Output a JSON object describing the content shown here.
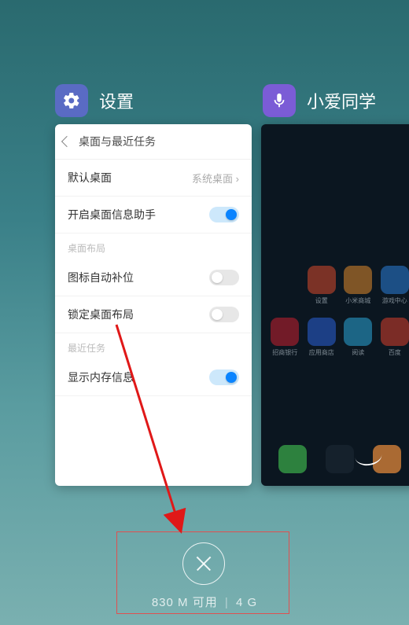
{
  "cards": {
    "left": {
      "title": "设置",
      "panel_title": "桌面与最近任务",
      "rows": [
        {
          "kind": "valueRow",
          "label": "默认桌面",
          "value": "系统桌面"
        },
        {
          "kind": "toggleRow",
          "label": "开启桌面信息助手",
          "on": true
        },
        {
          "kind": "section",
          "label": "桌面布局"
        },
        {
          "kind": "toggleRow",
          "label": "图标自动补位",
          "on": false
        },
        {
          "kind": "toggleRow",
          "label": "锁定桌面布局",
          "on": false
        },
        {
          "kind": "section",
          "label": "最近任务"
        },
        {
          "kind": "toggleRow",
          "label": "显示内存信息",
          "on": true
        }
      ]
    },
    "right": {
      "title": "小爱同学",
      "apps_row1": [
        {
          "name": "设置",
          "color": "#d84a2c"
        },
        {
          "name": "小米商城",
          "color": "#e08a2c"
        },
        {
          "name": "游戏中心",
          "color": "#2c7fd8"
        }
      ],
      "apps_row2": [
        {
          "name": "招商银行",
          "color": "#c92030"
        },
        {
          "name": "应用商店",
          "color": "#2c62d8"
        },
        {
          "name": "阅读",
          "color": "#2ca8d8"
        },
        {
          "name": "百度",
          "color": "#d8402c"
        }
      ],
      "dock": [
        {
          "name": "phone-icon",
          "color": "#3aa648"
        },
        {
          "name": "messages-icon",
          "color": "#1a2530"
        },
        {
          "name": "browser-icon",
          "color": "#e0873a"
        }
      ]
    }
  },
  "memory": {
    "available": "830 M 可用",
    "total": "4 G"
  }
}
